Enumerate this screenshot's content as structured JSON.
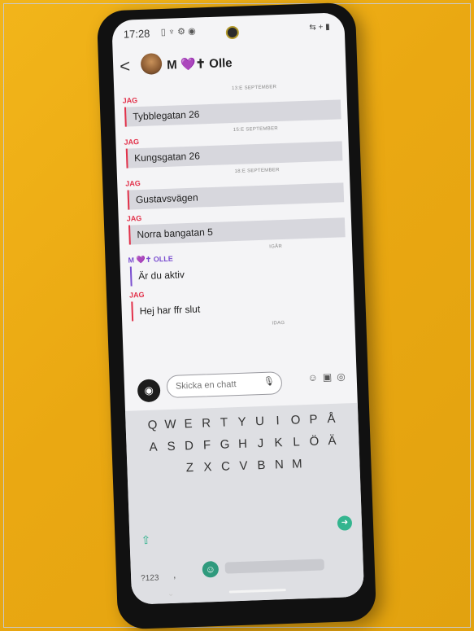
{
  "status": {
    "time": "17:28"
  },
  "header": {
    "back": "<",
    "title": "M 💜✝ Olle"
  },
  "messages": [
    {
      "sender": "JAG",
      "date": "13:E SEPTEMBER",
      "text": "Tybblegatan 26",
      "from_me": true
    },
    {
      "sender": "JAG",
      "date": "15:E SEPTEMBER",
      "text": "Kungsgatan 26",
      "from_me": true
    },
    {
      "sender": "JAG",
      "date": "18:E SEPTEMBER",
      "text": "Gustavsvägen",
      "from_me": true
    },
    {
      "sender": "JAG",
      "date": "",
      "text": "Norra bangatan 5",
      "from_me": true
    },
    {
      "sender": "M 💜✝ OLLE",
      "date": "IGÅR",
      "text": "Är du aktiv",
      "from_me": false
    },
    {
      "sender": "JAG",
      "date": "",
      "text": "Hej har ffr slut",
      "from_me": true
    }
  ],
  "today_label": "IDAG",
  "composer": {
    "placeholder": "Skicka en chatt"
  },
  "keyboard": {
    "row1": [
      "Q",
      "W",
      "E",
      "R",
      "T",
      "Y",
      "U",
      "I",
      "O",
      "P",
      "Å"
    ],
    "row2": [
      "A",
      "S",
      "D",
      "F",
      "G",
      "H",
      "J",
      "K",
      "L",
      "Ö",
      "Ä"
    ],
    "row3": [
      "Z",
      "X",
      "C",
      "V",
      "B",
      "N",
      "M"
    ],
    "sym": "?123",
    "comma": ","
  },
  "colors": {
    "me": "#e2314a",
    "other": "#7b4fd0",
    "desk": "#eaa812"
  }
}
